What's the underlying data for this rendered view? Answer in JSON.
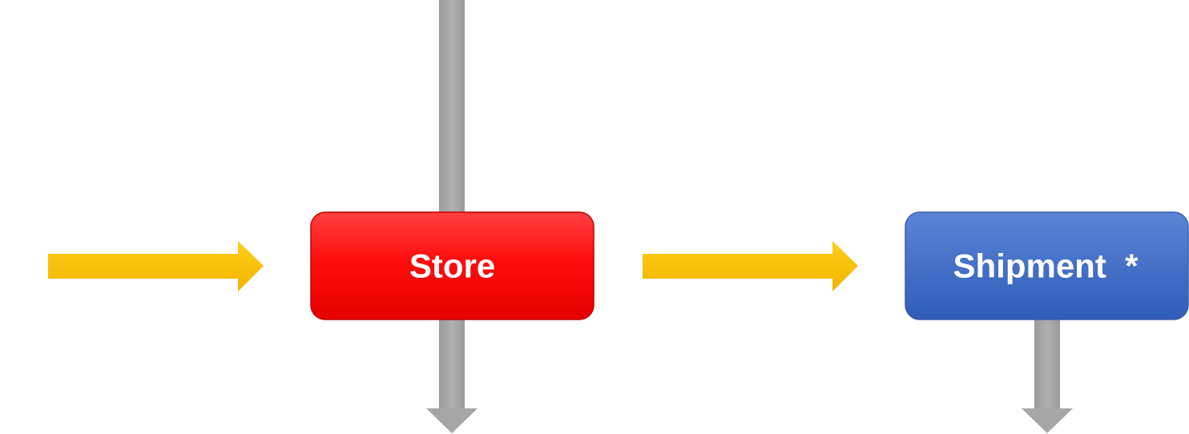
{
  "nodes": {
    "store": {
      "label": "Store",
      "color": "#ff1a1a",
      "border": "#c40000"
    },
    "shipment": {
      "label": "Shipment  *",
      "color": "#4a72c8",
      "border": "#3a5fae"
    }
  },
  "colors": {
    "flow_arrow": "#ffc20e",
    "vertical_arrow": "#a6a6a6",
    "background": "#ffffff"
  }
}
